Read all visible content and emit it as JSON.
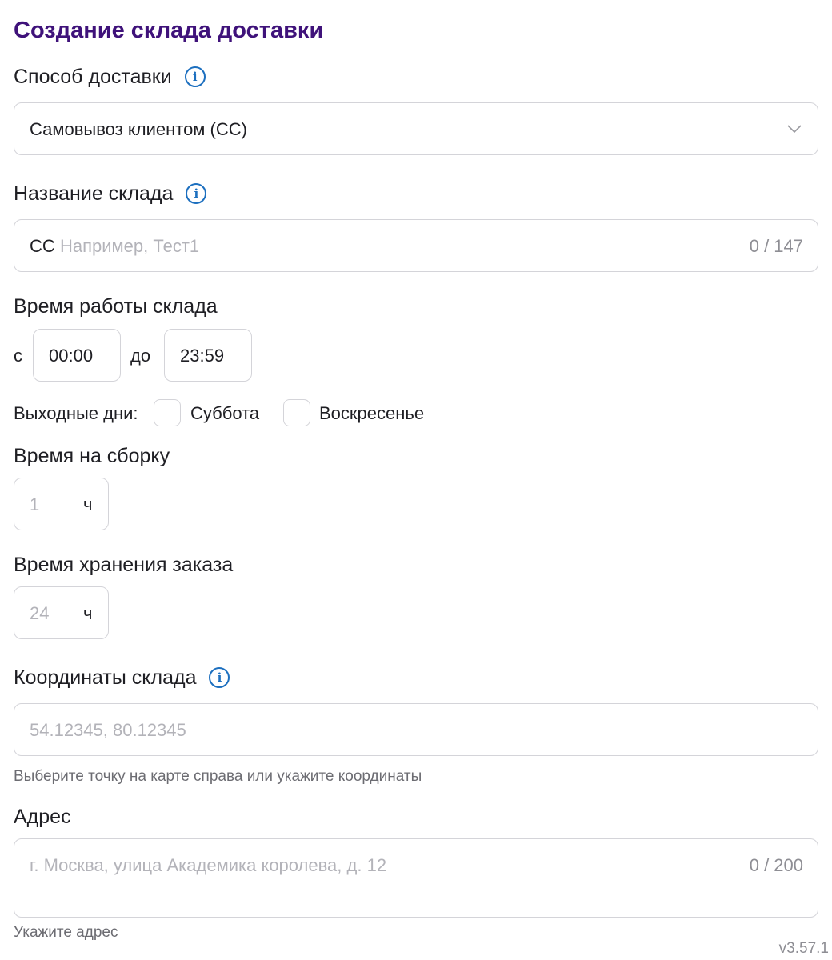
{
  "page": {
    "title": "Создание склада доставки",
    "version": "v3.57.1"
  },
  "delivery_method": {
    "label": "Способ доставки",
    "selected": "Самовывоз клиентом (СС)"
  },
  "warehouse_name": {
    "label": "Название склада",
    "prefix": "СС",
    "placeholder": "Например, Тест1",
    "counter": "0 / 147"
  },
  "working_hours": {
    "label": "Время работы склада",
    "from_label": "с",
    "from_value": "00:00",
    "to_label": "до",
    "to_value": "23:59"
  },
  "days_off": {
    "label": "Выходные дни:",
    "saturday": "Суббота",
    "sunday": "Воскресенье"
  },
  "assembly_time": {
    "label": "Время на сборку",
    "placeholder": "1",
    "unit": "ч"
  },
  "storage_time": {
    "label": "Время хранения заказа",
    "placeholder": "24",
    "unit": "ч"
  },
  "coordinates": {
    "label": "Координаты склада",
    "placeholder": "54.12345, 80.12345",
    "hint": "Выберите точку на карте справа или укажите координаты"
  },
  "address": {
    "label": "Адрес",
    "placeholder": "г. Москва, улица Академика королева, д. 12",
    "counter": "0 / 200",
    "hint": "Укажите адрес"
  },
  "colors": {
    "title": "#3f127a",
    "info_icon": "#1c6fbf",
    "border": "#d4d4d9"
  }
}
